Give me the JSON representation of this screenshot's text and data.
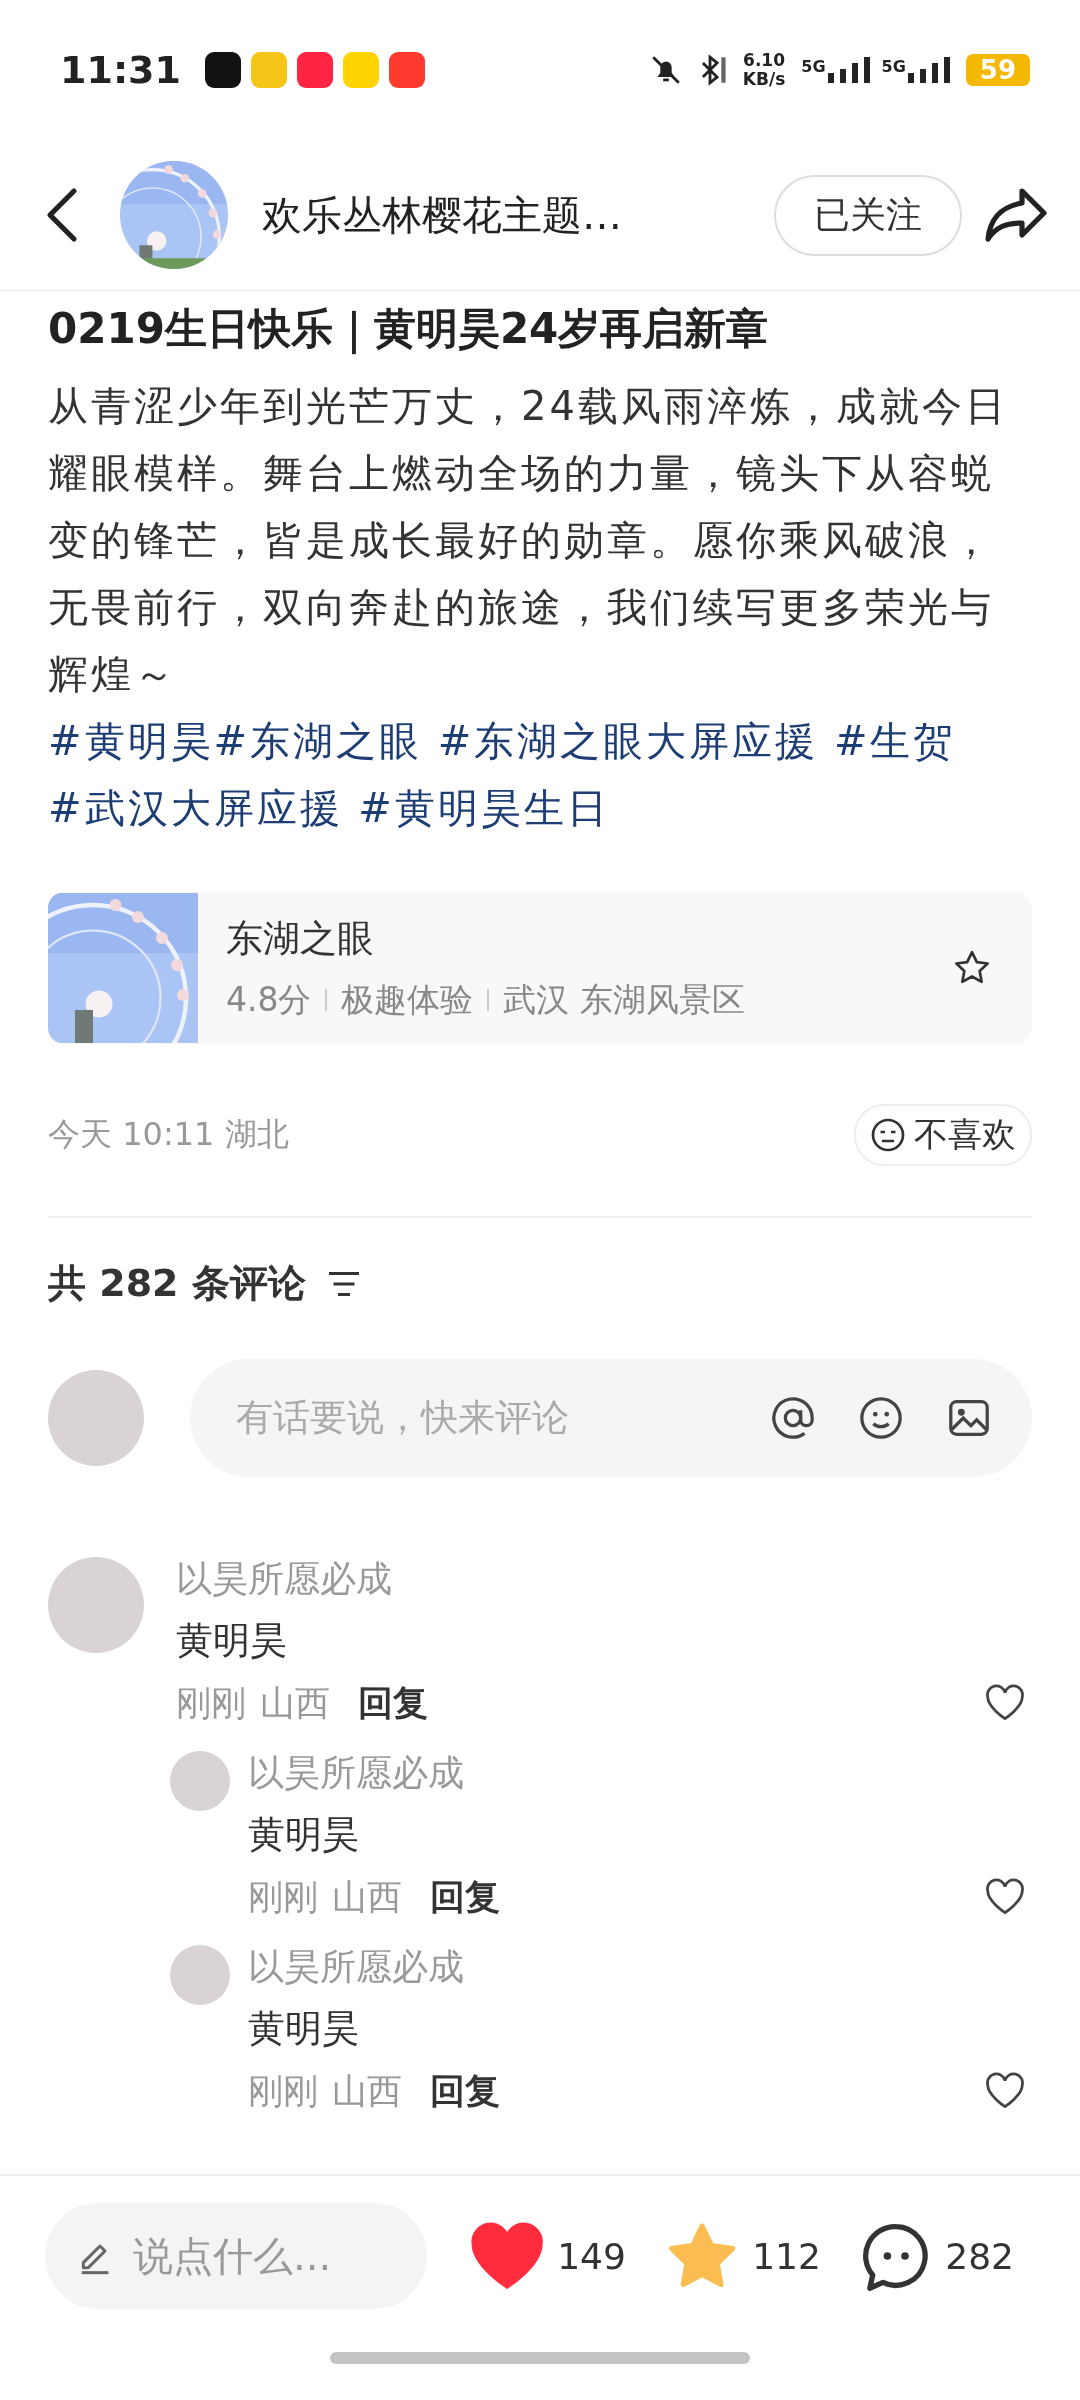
{
  "status_bar": {
    "time": "11:31",
    "app_icons": [
      {
        "color": "#111111"
      },
      {
        "color": "#f5c518"
      },
      {
        "color": "#ff2442"
      },
      {
        "color": "#ffd400"
      },
      {
        "color": "#ff3b30"
      }
    ],
    "net_speed_value": "6.10",
    "net_speed_unit": "KB/s",
    "sim_labels": [
      "5G",
      "5G"
    ],
    "battery": "59"
  },
  "header": {
    "author": "欢乐丛林樱花主题…",
    "follow_button": "已关注"
  },
  "post": {
    "title": "0219生日快乐｜黄明昊24岁再启新章",
    "body": "从青涩少年到光芒万丈，24载风雨淬炼，成就今日耀眼模样。舞台上燃动全场的力量，镜头下从容蜕变的锋芒，皆是成长最好的勋章。愿你乘风破浪，无畏前行，双向奔赴的旅途，我们续写更多荣光与辉煌～",
    "tags": "#黄明昊#东湖之眼 #东湖之眼大屏应援 #生贺 #武汉大屏应援 #黄明昊生日",
    "place": {
      "name": "东湖之眼",
      "meta": [
        "4.8分",
        "极趣体验",
        "武汉 东湖风景区"
      ]
    },
    "time": "今天 10:11 湖北",
    "dislike_button": "不喜欢"
  },
  "comments_header": {
    "count": "共 282 条评论"
  },
  "comment_input": {
    "placeholder": "有话要说，快来评论"
  },
  "comments": [
    {
      "author": "以昊所愿必成",
      "text": "黄明昊",
      "time": "刚刚",
      "location": "山西",
      "reply": "回复",
      "children": [
        {
          "author": "以昊所愿必成",
          "text": "黄明昊",
          "time": "刚刚",
          "location": "山西",
          "reply": "回复"
        },
        {
          "author": "以昊所愿必成",
          "text": "黄明昊",
          "time": "刚刚",
          "location": "山西",
          "reply": "回复"
        }
      ]
    }
  ],
  "bottom_bar": {
    "placeholder": "说点什么...",
    "likes": "149",
    "liked": true,
    "favorites": "112",
    "favorited": true,
    "comments": "282"
  }
}
